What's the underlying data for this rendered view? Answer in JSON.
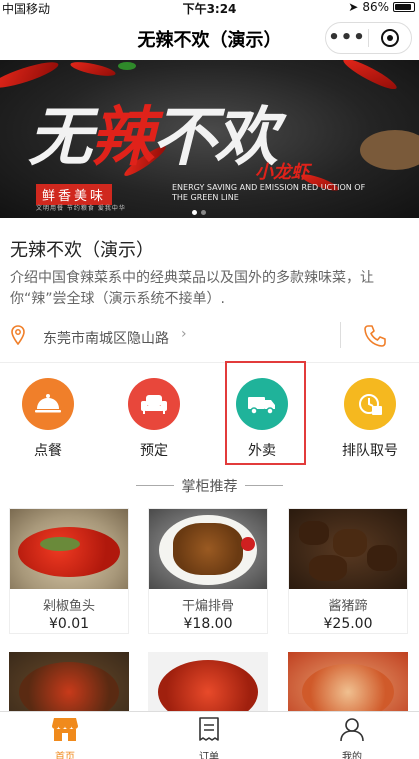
{
  "status_bar": {
    "carrier": "中国移动",
    "time": "下午3:24",
    "battery": "86%"
  },
  "nav": {
    "title": "无辣不欢（演示）",
    "more": "•••"
  },
  "banner": {
    "main_text_1": "无",
    "main_text_2": "辣",
    "main_text_3": "不欢",
    "sub_text": "小龙虾",
    "tag": "鲜香美味",
    "tag_small": "文明用餐 节约粮食 爱我中华",
    "english": "ENERGY SAVING AND EMISSION RED UCTION OF THE GREEN LINE"
  },
  "shop": {
    "name": "无辣不欢（演示）",
    "description": "介绍中国食辣菜系中的经典菜品以及国外的多款辣味菜，让你“辣”尝全球（演示系统不接单）.",
    "address": "东莞市南城区隐山路",
    "address_chevron": "›"
  },
  "services": [
    {
      "label": "点餐",
      "icon": "cloche-icon",
      "color": "#f07f2a"
    },
    {
      "label": "预定",
      "icon": "sofa-icon",
      "color": "#e8473b"
    },
    {
      "label": "外卖",
      "icon": "delivery-truck-icon",
      "color": "#1fb39a"
    },
    {
      "label": "排队取号",
      "icon": "queue-ticket-icon",
      "color": "#f5b81f"
    }
  ],
  "recommend_title": "掌柜推荐",
  "dishes": [
    {
      "name": "剁椒鱼头",
      "price": "¥0.01"
    },
    {
      "name": "干煸排骨",
      "price": "¥18.00"
    },
    {
      "name": "酱猪蹄",
      "price": "¥25.00"
    }
  ],
  "tabs": [
    {
      "label": "首页",
      "icon": "store-icon"
    },
    {
      "label": "订单",
      "icon": "receipt-icon"
    },
    {
      "label": "我的",
      "icon": "user-icon"
    }
  ],
  "colors": {
    "accent": "#f08a1c",
    "highlight_box": "#e23b3b",
    "phone_icon": "#f07f2a"
  }
}
